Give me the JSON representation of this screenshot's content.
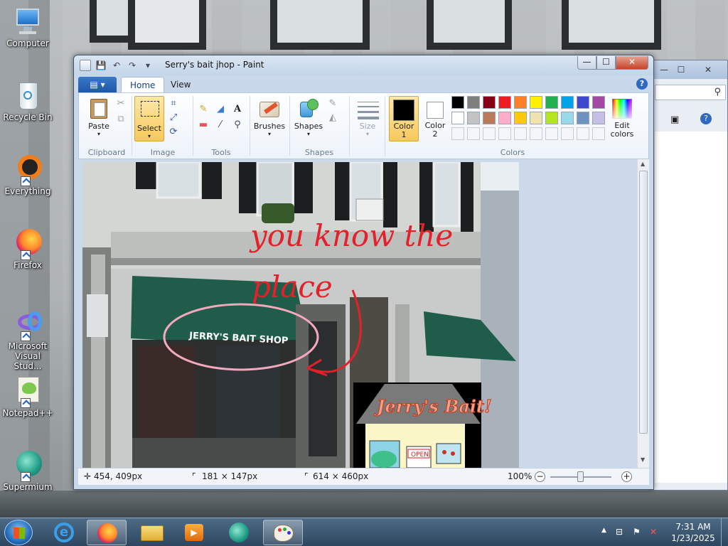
{
  "desktop": {
    "icons": [
      {
        "label": "Computer"
      },
      {
        "label": "Recycle Bin"
      },
      {
        "label": "Everything"
      },
      {
        "label": "Firefox"
      },
      {
        "label": "Microsoft Visual Stud..."
      },
      {
        "label": "Notepad++"
      },
      {
        "label": "Supermium"
      }
    ]
  },
  "paint": {
    "title": "Serry's bait jhop - Paint",
    "tabs": {
      "file": "▾",
      "home": "Home",
      "view": "View"
    },
    "clipboard": {
      "paste": "Paste",
      "group": "Clipboard"
    },
    "image": {
      "select": "Select",
      "group": "Image"
    },
    "tools": {
      "group": "Tools"
    },
    "brushes": {
      "label": "Brushes"
    },
    "shapes": {
      "label": "Shapes",
      "group": "Shapes"
    },
    "size": {
      "label": "Size"
    },
    "colors": {
      "color1": "Color 1",
      "color2": "Color 2",
      "edit": "Edit colors",
      "group": "Colors",
      "color1_value": "#000000",
      "color2_value": "#ffffff",
      "row1": [
        "#000000",
        "#7f7f7f",
        "#880015",
        "#ed1c24",
        "#ff7f27",
        "#fff200",
        "#22b14c",
        "#00a2e8",
        "#3f48cc",
        "#a349a4"
      ],
      "row2": [
        "#ffffff",
        "#c3c3c3",
        "#b97a57",
        "#ffaec9",
        "#ffc90e",
        "#efe4b0",
        "#b5e61d",
        "#99d9ea",
        "#7092be",
        "#c8bfe7"
      ]
    },
    "canvas": {
      "handwriting1": "you know the",
      "handwriting2": "place",
      "sign": "JERRY'S BAIT SHOP",
      "drawing_sign": "Jerry's Bait!",
      "open_sign": "OPEN"
    },
    "status": {
      "cursor": "454, 409px",
      "selection": "181 × 147px",
      "image_size": "614 × 460px",
      "zoom": "100%",
      "zoom_out": "−",
      "zoom_in": "+"
    }
  },
  "taskbar": {
    "time": "7:31 AM",
    "date": "1/23/2025"
  }
}
